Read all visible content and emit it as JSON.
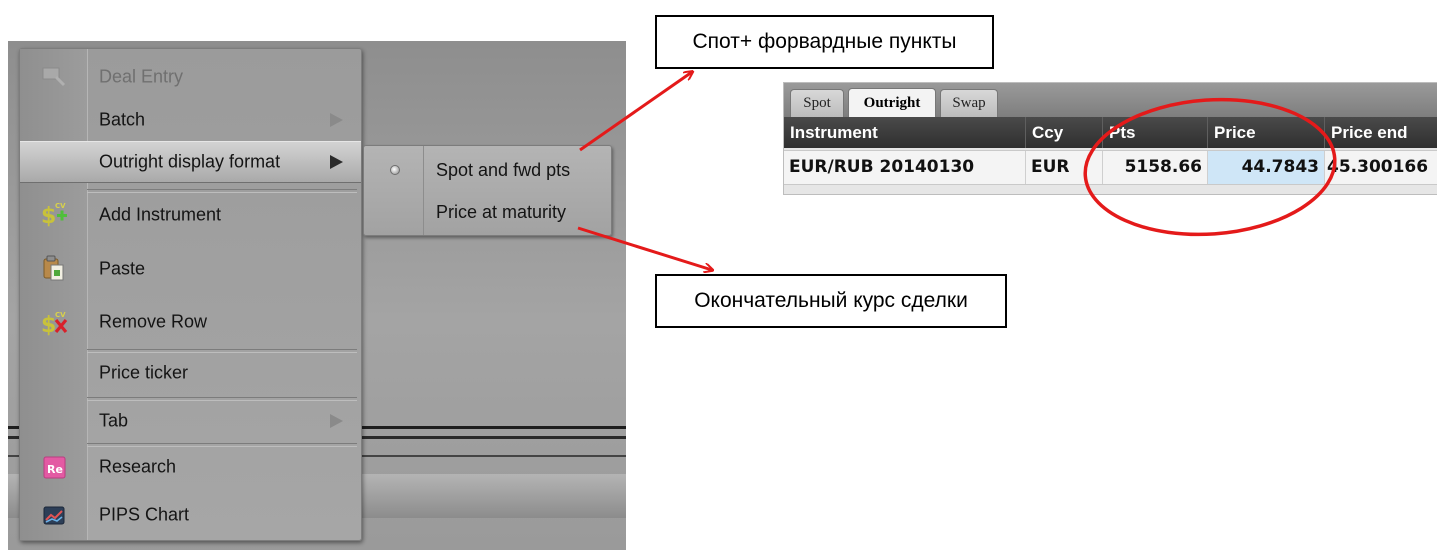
{
  "context_menu": {
    "items": [
      {
        "label": "Deal Entry",
        "disabled": true
      },
      {
        "label": "Batch",
        "submenu": true
      },
      {
        "label": "Outright display format",
        "submenu": true,
        "highlighted": true
      },
      {
        "label": "Add Instrument",
        "icon": "add-instrument-icon"
      },
      {
        "label": "Paste",
        "icon": "paste-icon"
      },
      {
        "label": "Remove Row",
        "icon": "remove-row-icon"
      },
      {
        "label": "Price ticker"
      },
      {
        "label": "Tab",
        "submenu": true
      },
      {
        "label": "Research",
        "icon": "research-icon"
      },
      {
        "label": "PIPS Chart",
        "icon": "pips-chart-icon"
      }
    ],
    "icon_text": {
      "add": "$",
      "add_sup": "CV",
      "research": "Re"
    }
  },
  "submenu": {
    "items": [
      {
        "label": "Spot and fwd pts",
        "selected": true
      },
      {
        "label": "Price at maturity",
        "selected": false
      }
    ]
  },
  "callouts": {
    "top": "Спот+ форвардные пункты",
    "bottom": "Окончательный курс сделки"
  },
  "grid": {
    "tabs": [
      {
        "label": "Spot",
        "active": false
      },
      {
        "label": "Outright",
        "active": true
      },
      {
        "label": "Swap",
        "active": false
      }
    ],
    "columns": [
      "Instrument",
      "Ccy",
      "Pts",
      "Price",
      "Price end"
    ],
    "row": {
      "instrument": "EUR/RUB 20140130",
      "ccy": "EUR",
      "pts": "5158.66",
      "price": "44.7843",
      "price_end": "45.300166"
    }
  },
  "colors": {
    "annotation_red": "#e41a1a",
    "price_cell_bg": "#cfe6f7",
    "header_bg": "#3a3a3a"
  }
}
